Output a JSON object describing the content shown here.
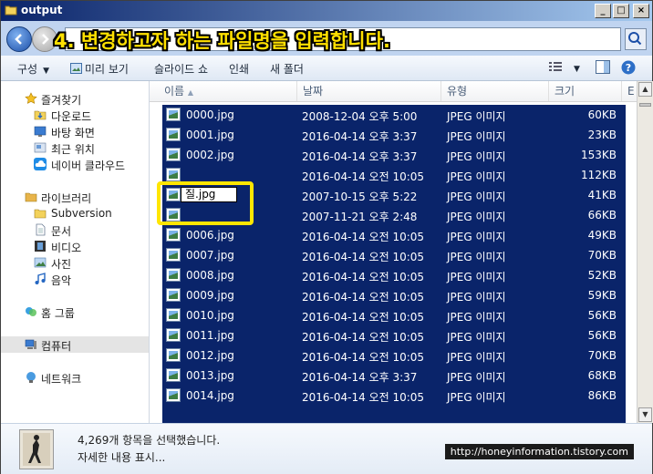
{
  "window": {
    "title": "output"
  },
  "overlay": {
    "caption": "4. 변경하고자 하는 파일명을 입력합니다."
  },
  "toolbar": {
    "organize": "구성",
    "preview": "미리 보기",
    "slideshow": "슬라이드 쇼",
    "print": "인쇄",
    "new_folder": "새 폴더"
  },
  "sidebar": {
    "favorites": "즐겨찾기",
    "downloads": "다운로드",
    "desktop": "바탕 화면",
    "recent": "최근 위치",
    "naver_cloud": "네이버 클라우드",
    "libraries": "라이브러리",
    "subversion": "Subversion",
    "documents": "문서",
    "videos": "비디오",
    "pictures": "사진",
    "music": "음악",
    "homegroup": "홈 그룹",
    "computer": "컴퓨터",
    "network": "네트워크"
  },
  "columns": {
    "name": "이름",
    "date": "날짜",
    "type": "유형",
    "size": "크기",
    "extra": "E"
  },
  "files": [
    {
      "name": "0000.jpg",
      "date": "2008-12-04 오후 5:00",
      "type": "JPEG 이미지",
      "size": "60KB"
    },
    {
      "name": "0001.jpg",
      "date": "2016-04-14 오후 3:37",
      "type": "JPEG 이미지",
      "size": "23KB"
    },
    {
      "name": "0002.jpg",
      "date": "2016-04-14 오후 3:37",
      "type": "JPEG 이미지",
      "size": "153KB"
    },
    {
      "name": "",
      "date": "2016-04-14 오전 10:05",
      "type": "JPEG 이미지",
      "size": "112KB"
    },
    {
      "name": "",
      "date": "2007-10-15 오후 5:22",
      "type": "JPEG 이미지",
      "size": "41KB"
    },
    {
      "name": "",
      "date": "2007-11-21 오후 2:48",
      "type": "JPEG 이미지",
      "size": "66KB"
    },
    {
      "name": "0006.jpg",
      "date": "2016-04-14 오전 10:05",
      "type": "JPEG 이미지",
      "size": "49KB"
    },
    {
      "name": "0007.jpg",
      "date": "2016-04-14 오전 10:05",
      "type": "JPEG 이미지",
      "size": "70KB"
    },
    {
      "name": "0008.jpg",
      "date": "2016-04-14 오전 10:05",
      "type": "JPEG 이미지",
      "size": "52KB"
    },
    {
      "name": "0009.jpg",
      "date": "2016-04-14 오전 10:05",
      "type": "JPEG 이미지",
      "size": "59KB"
    },
    {
      "name": "0010.jpg",
      "date": "2016-04-14 오전 10:05",
      "type": "JPEG 이미지",
      "size": "56KB"
    },
    {
      "name": "0011.jpg",
      "date": "2016-04-14 오전 10:05",
      "type": "JPEG 이미지",
      "size": "56KB"
    },
    {
      "name": "0012.jpg",
      "date": "2016-04-14 오전 10:05",
      "type": "JPEG 이미지",
      "size": "70KB"
    },
    {
      "name": "0013.jpg",
      "date": "2016-04-14 오후 3:37",
      "type": "JPEG 이미지",
      "size": "68KB"
    },
    {
      "name": "0014.jpg",
      "date": "2016-04-14 오전 10:05",
      "type": "JPEG 이미지",
      "size": "86KB"
    }
  ],
  "rename": {
    "value": "질.jpg"
  },
  "details": {
    "selected": "4,269개 항목을 선택했습니다.",
    "more": "자세한 내용 표시...",
    "url": "http://honeyinformation.tistory.com"
  },
  "colors": {
    "selection": "#0a246a",
    "highlight": "#ffe600",
    "caption": "#ffe000"
  }
}
